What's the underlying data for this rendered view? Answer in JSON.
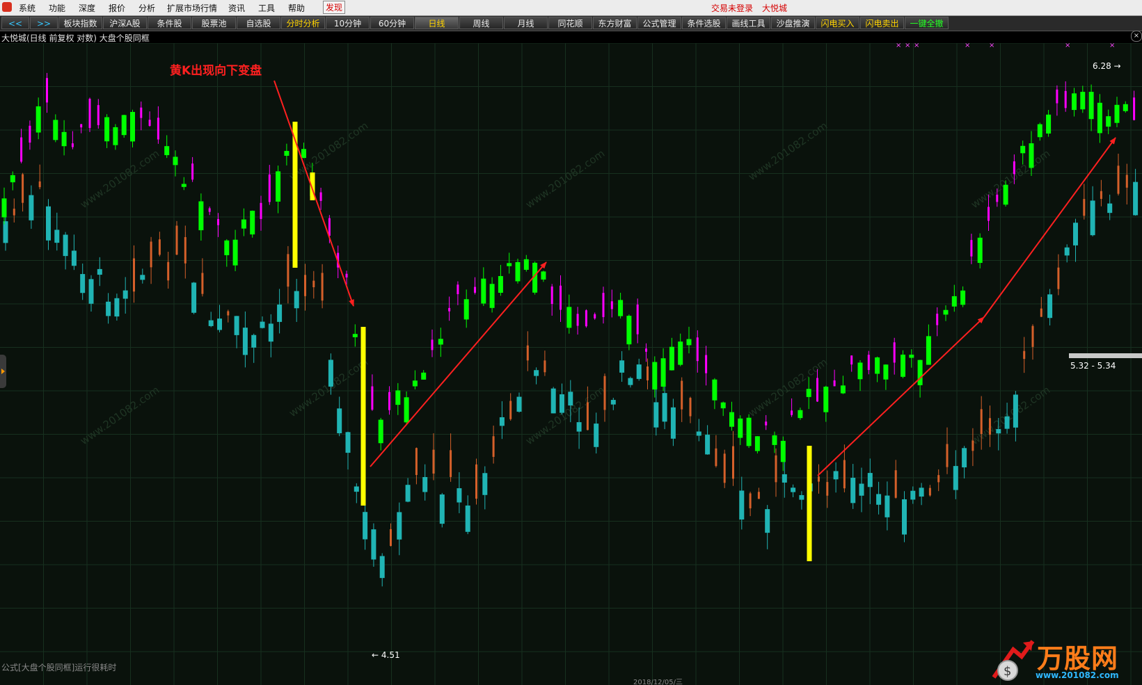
{
  "menu": {
    "items": [
      "系统",
      "功能",
      "深度",
      "报价",
      "分析",
      "扩展市场行情",
      "资讯",
      "工具",
      "帮助"
    ],
    "discover": "发现",
    "trade_status": "交易未登录",
    "stock_name": "大悦城"
  },
  "toolbar": {
    "back": "<<",
    "forward": ">>",
    "buttons": [
      "板块指数",
      "沪深A股",
      "条件股",
      "股票池",
      "自选股",
      "分时分析",
      "10分钟",
      "60分钟",
      "日线",
      "周线",
      "月线",
      "同花顺",
      "东方财富",
      "公式管理",
      "条件选股",
      "画线工具",
      "沙盘推演",
      "闪电买入",
      "闪电卖出",
      "一键全撤"
    ],
    "active": "日线"
  },
  "chart_title": "大悦城(日线 前复权 对数) 大盘个股同框",
  "close_glyph": "×",
  "footer_text": "公式[大盘个股同框]运行很耗时",
  "logo": {
    "name": "万股网",
    "url": "www.201082.com"
  },
  "watermark": "www.201082.com",
  "colors": {
    "background": "#0a120c",
    "grid": "#17301f",
    "stock_up": "#ff00ff",
    "stock_down": "#00ff00",
    "index_up": "#d5602a",
    "index_down": "#20b4b4",
    "highlight": "#ffff00",
    "annotation": "#ff2020"
  },
  "chart_data": {
    "type": "candlestick",
    "title": "大悦城(日线 前复权 对数) 大盘个股同框",
    "scale": "log",
    "annotation": "黄K出现向下变盘",
    "min_label": "4.51",
    "max_label": "6.28",
    "price_range_label": "5.32 - 5.34",
    "x_axis_date_label": "2018/12/05/三",
    "grid": true
  }
}
